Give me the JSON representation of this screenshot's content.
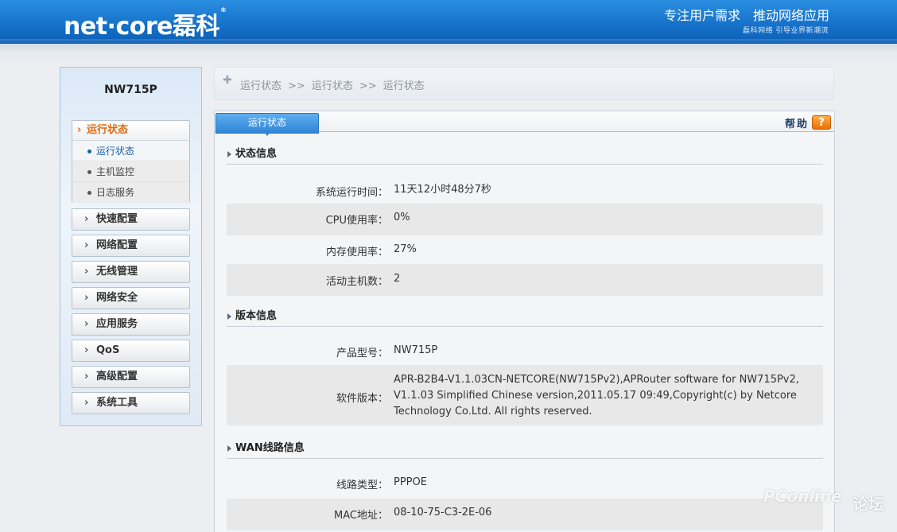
{
  "header": {
    "logo_text": "net·core磊科",
    "logo_mark": "®",
    "slogan": "专注用户需求　推动网络应用",
    "slogan_sub": "磊科网络 引导业界新潮流"
  },
  "sidebar": {
    "model": "NW715P",
    "menu_head": "运行状态",
    "sub_items": [
      {
        "label": "运行状态",
        "active": true
      },
      {
        "label": "主机监控",
        "active": false
      },
      {
        "label": "日志服务",
        "active": false
      }
    ],
    "nav_items": [
      "快速配置",
      "网络配置",
      "无线管理",
      "网络安全",
      "应用服务",
      "QoS",
      "高级配置",
      "系统工具"
    ]
  },
  "breadcrumb": {
    "items": [
      "运行状态",
      "运行状态",
      "运行状态"
    ],
    "separator": ">>"
  },
  "panel": {
    "tab_label": "运行状态",
    "help_label": "帮助",
    "help_icon": "?",
    "sections": [
      {
        "title": "状态信息",
        "rows": [
          {
            "label": "系统运行时间：",
            "value": "11天12小时48分7秒"
          },
          {
            "label": "CPU使用率：",
            "value": "0%"
          },
          {
            "label": "内存使用率：",
            "value": "27%"
          },
          {
            "label": "活动主机数：",
            "value": "2"
          }
        ]
      },
      {
        "title": "版本信息",
        "rows": [
          {
            "label": "产品型号：",
            "value": "NW715P"
          },
          {
            "label": "软件版本：",
            "value": "APR-B2B4-V1.1.03CN-NETCORE(NW715Pv2),APRouter software for NW715Pv2, V1.1.03 Simplified Chinese version,2011.05.17 09:49,Copyright(c) by Netcore Technology Co.Ltd. All rights reserved."
          }
        ]
      },
      {
        "title": "WAN线路信息",
        "rows": [
          {
            "label": "线路类型：",
            "value": "PPPOE"
          },
          {
            "label": "MAC地址：",
            "value": "08-10-75-C3-2E-06"
          }
        ]
      }
    ]
  },
  "watermark": {
    "text": "PConline",
    "text2": "论坛"
  }
}
